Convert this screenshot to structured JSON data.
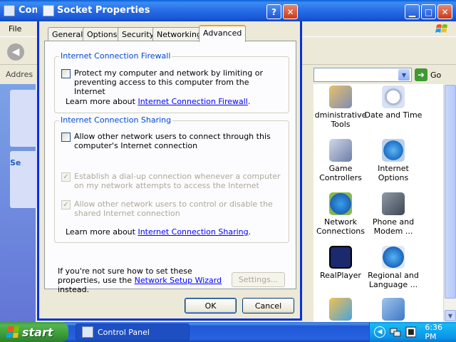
{
  "background_window": {
    "title": "Con",
    "menu": {
      "file": "File"
    },
    "address_label": "Addres",
    "go_label": "Go",
    "sidebar_text": "Se",
    "items": [
      {
        "label": "dministrative Tools",
        "icon": "administrative-tools-icon"
      },
      {
        "label": "Date and Time",
        "icon": "date-time-icon"
      },
      {
        "label": "Game Controllers",
        "icon": "game-controllers-icon"
      },
      {
        "label": "Internet Options",
        "icon": "internet-options-icon"
      },
      {
        "label": "Network Connections",
        "icon": "network-connections-icon"
      },
      {
        "label": "Phone and Modem ...",
        "icon": "phone-modem-icon"
      },
      {
        "label": "RealPlayer",
        "icon": "realplayer-icon"
      },
      {
        "label": "Regional and Language ...",
        "icon": "regional-language-icon"
      }
    ]
  },
  "dialog": {
    "title": "Socket Properties",
    "help_button": "?",
    "close_button": "✕",
    "tabs": [
      {
        "label": "General",
        "active": false
      },
      {
        "label": "Options",
        "active": false
      },
      {
        "label": "Security",
        "active": false
      },
      {
        "label": "Networking",
        "active": false
      },
      {
        "label": "Advanced",
        "active": true
      }
    ],
    "firewall": {
      "title": "Internet Connection Firewall",
      "checkbox_label": "Protect my computer and network by limiting or preventing access to this computer from the Internet",
      "checked": false,
      "learn_prefix": "Learn more about ",
      "learn_link": "Internet Connection Firewall",
      "learn_suffix": "."
    },
    "sharing": {
      "title": "Internet Connection Sharing",
      "allow_connect": "Allow other network users to connect through this computer's Internet connection",
      "establish_dialup": "Establish a dial-up connection whenever a computer on my network attempts to access the Internet",
      "allow_control": "Allow other network users to control or disable the shared Internet connection",
      "learn_prefix": "Learn more about ",
      "learn_link": "Internet Connection Sharing",
      "learn_suffix": "."
    },
    "help_text_prefix": "If you're not sure how to set these properties, use the ",
    "help_text_link": "Network Setup Wizard",
    "help_text_suffix": " instead.",
    "settings_button": "Settings...",
    "ok_button": "OK",
    "cancel_button": "Cancel"
  },
  "taskbar": {
    "start_label": "start",
    "task_label": "Control Panel",
    "clock": "6:36 PM"
  }
}
